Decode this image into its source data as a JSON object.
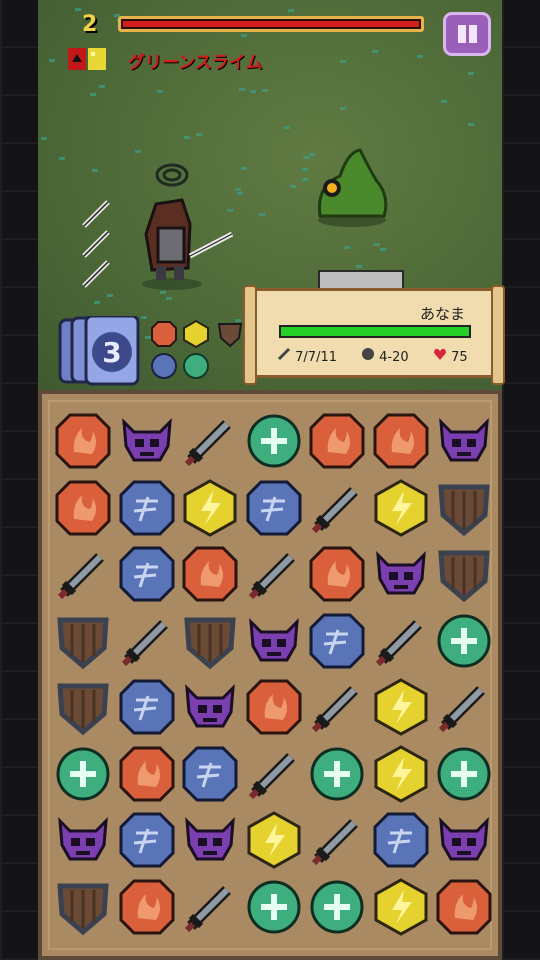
{
  "hud": {
    "level": "2",
    "enemy_hp_fraction": 1.0,
    "enemy_name": "グリーンスライム",
    "pause_icon": "pause-icon"
  },
  "hero": {
    "name": "あなま",
    "hp_fraction": 1.0,
    "attack": "7/7/11",
    "defense": "4-20",
    "hp": "75"
  },
  "skill": {
    "charge": "3"
  },
  "colors": {
    "enemy_hp": "#d21d1d",
    "hero_hp": "#27d027",
    "level": "#f2d24a",
    "pause": "#9a5fb8",
    "fire": "#d9603a",
    "water": "#5a74b8",
    "lightning": "#e6d22e",
    "heal": "#3fae7f",
    "skull": "#7b3fb0",
    "shield": "#6b4a36",
    "sword": "#8f9aa5"
  },
  "board": {
    "rows": [
      [
        "fire",
        "skull",
        "sword",
        "heal",
        "fire",
        "fire",
        "skull"
      ],
      [
        "fire",
        "water",
        "lightning",
        "water",
        "sword",
        "lightning",
        "shield"
      ],
      [
        "sword",
        "water",
        "fire",
        "sword",
        "fire",
        "skull",
        "shield"
      ],
      [
        "shield",
        "sword",
        "shield",
        "skull",
        "water",
        "sword",
        "heal"
      ],
      [
        "shield",
        "water",
        "skull",
        "fire",
        "sword",
        "lightning",
        "sword"
      ],
      [
        "heal",
        "fire",
        "water",
        "sword",
        "heal",
        "lightning",
        "heal"
      ],
      [
        "skull",
        "water",
        "skull",
        "lightning",
        "sword",
        "water",
        "skull"
      ],
      [
        "shield",
        "fire",
        "sword",
        "heal",
        "heal",
        "lightning",
        "fire"
      ]
    ]
  }
}
